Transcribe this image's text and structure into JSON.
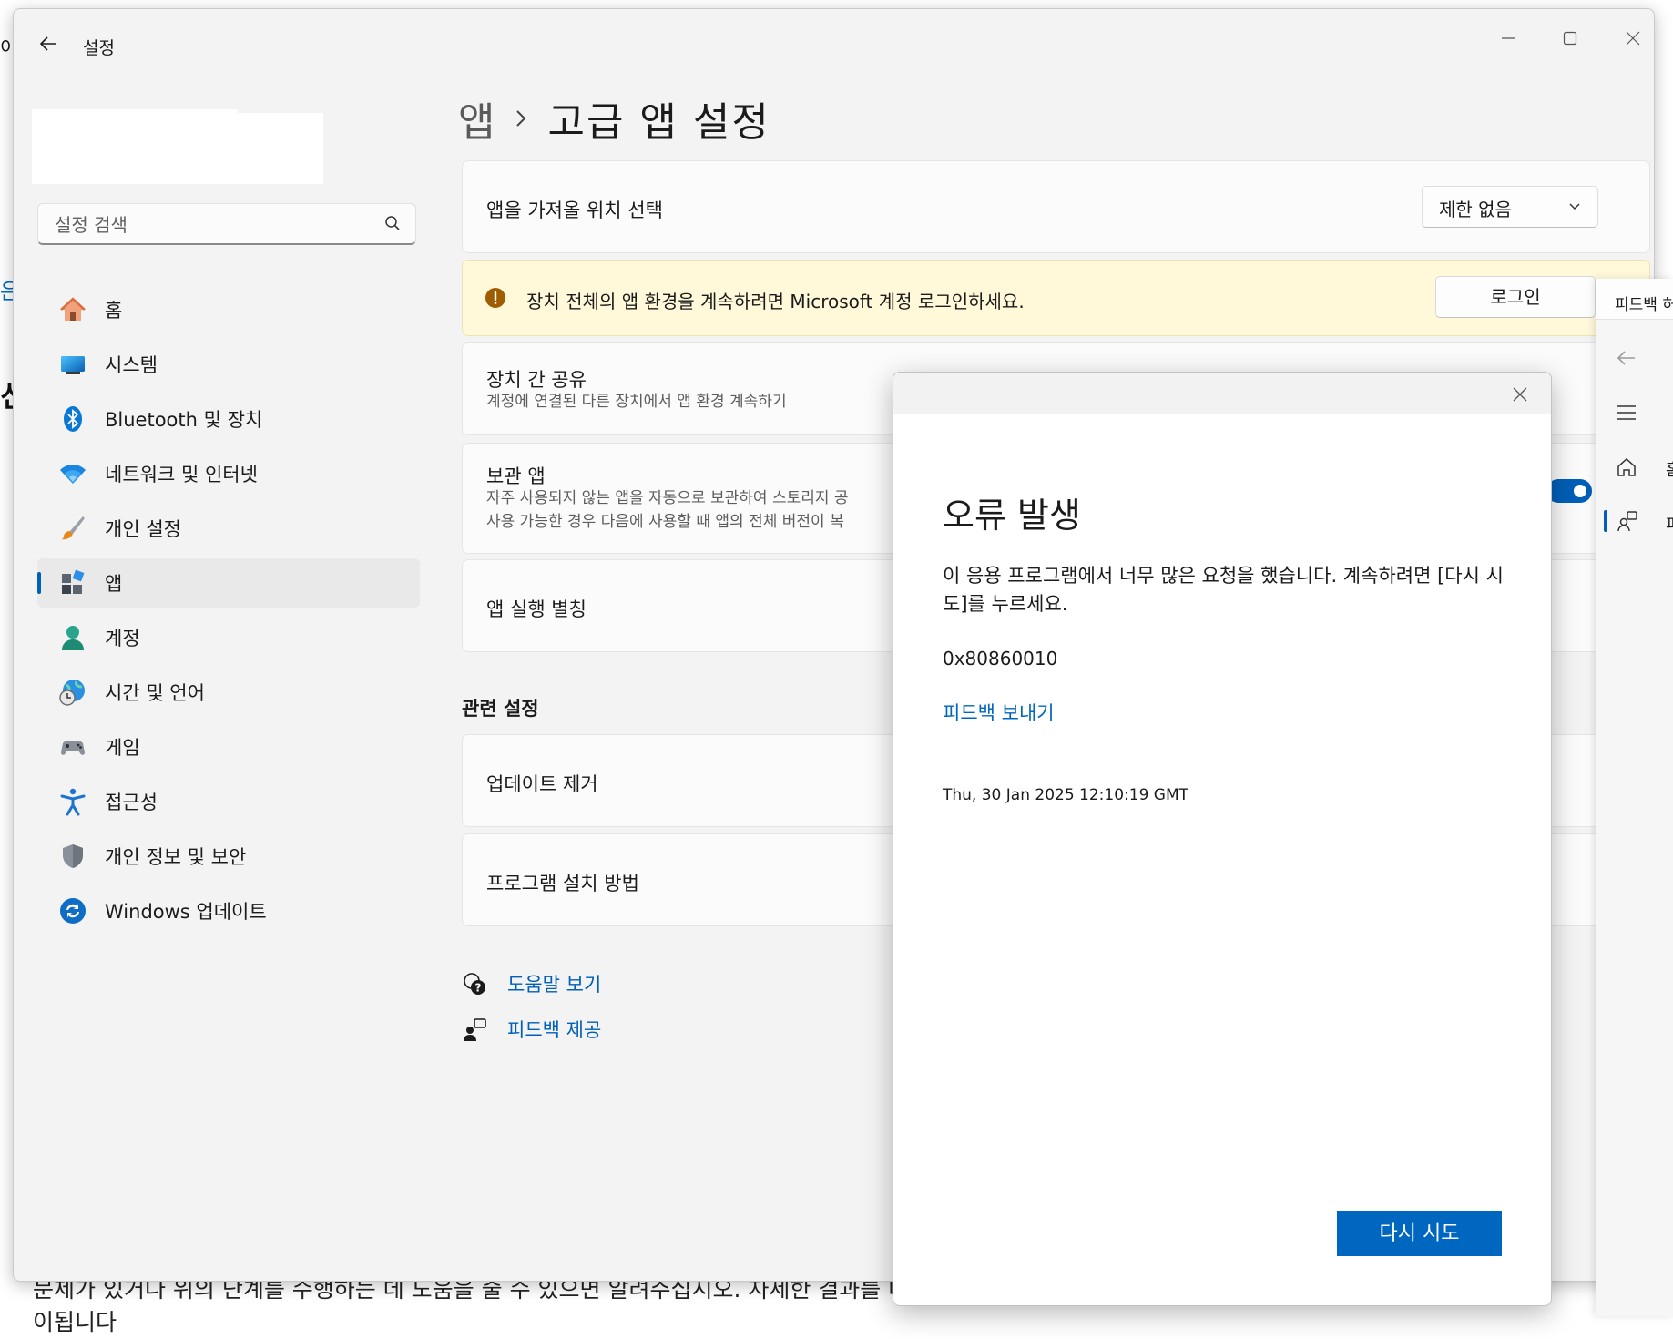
{
  "background": {
    "left_fragments": [
      "이",
      "은",
      "신"
    ],
    "bottom_line1": "문제가 있거나 위의 단계를 수행하는 데 도움을 줄 수 있으면 알려주십시오. 자세한 결과를 다시",
    "bottom_line2": "이됩니다"
  },
  "window": {
    "title": "설정"
  },
  "search": {
    "placeholder": "설정 검색"
  },
  "sidebar": {
    "items": [
      {
        "label": "홈",
        "icon": "home-icon"
      },
      {
        "label": "시스템",
        "icon": "system-icon"
      },
      {
        "label": "Bluetooth 및 장치",
        "icon": "bluetooth-icon"
      },
      {
        "label": "네트워크 및 인터넷",
        "icon": "wifi-icon"
      },
      {
        "label": "개인 설정",
        "icon": "brush-icon"
      },
      {
        "label": "앱",
        "icon": "apps-icon",
        "active": true
      },
      {
        "label": "계정",
        "icon": "account-icon"
      },
      {
        "label": "시간 및 언어",
        "icon": "globe-clock-icon"
      },
      {
        "label": "게임",
        "icon": "gamepad-icon"
      },
      {
        "label": "접근성",
        "icon": "accessibility-icon"
      },
      {
        "label": "개인 정보 및 보안",
        "icon": "shield-icon"
      },
      {
        "label": "Windows 업데이트",
        "icon": "update-icon"
      }
    ]
  },
  "breadcrumb": {
    "parent": "앱",
    "current": "고급 앱 설정"
  },
  "main": {
    "app_source": {
      "title": "앱을 가져올 위치 선택",
      "value": "제한 없음"
    },
    "banner": {
      "text": "장치 전체의 앱 환경을 계속하려면 Microsoft 계정 로그인하세요.",
      "button": "로그인",
      "color": "#fff8d9"
    },
    "share": {
      "title": "장치 간 공유",
      "desc": "계정에 연결된 다른 장치에서 앱 환경 계속하기"
    },
    "archive": {
      "title": "보관 앱",
      "desc1": "자주 사용되지 않는 앱을 자동으로 보관하여 스토리지 공",
      "desc2": "사용 가능한 경우 다음에 사용할 때 앱의 전체 버전이 복",
      "toggle_on": true
    },
    "aliases": {
      "title": "앱 실행 별칭"
    },
    "related_title": "관련 설정",
    "uninstall_updates": {
      "title": "업데이트 제거"
    },
    "install_programs": {
      "title": "프로그램 설치 방법"
    },
    "help_link": "도움말 보기",
    "feedback_link": "피드백 제공"
  },
  "feedback_panel": {
    "title": "피드백 허브",
    "home_text": "홈",
    "feedback_text": "피"
  },
  "dialog": {
    "title": "오류 발생",
    "message": "이 응용 프로그램에서 너무 많은 요청을 했습니다. 계속하려면 [다시 시도]를 누르세요.",
    "code": "0x80860010",
    "link": "피드백 보내기",
    "timestamp": "Thu, 30 Jan 2025 12:10:19 GMT",
    "retry_button": "다시 시도",
    "accent": "#0067c0"
  }
}
